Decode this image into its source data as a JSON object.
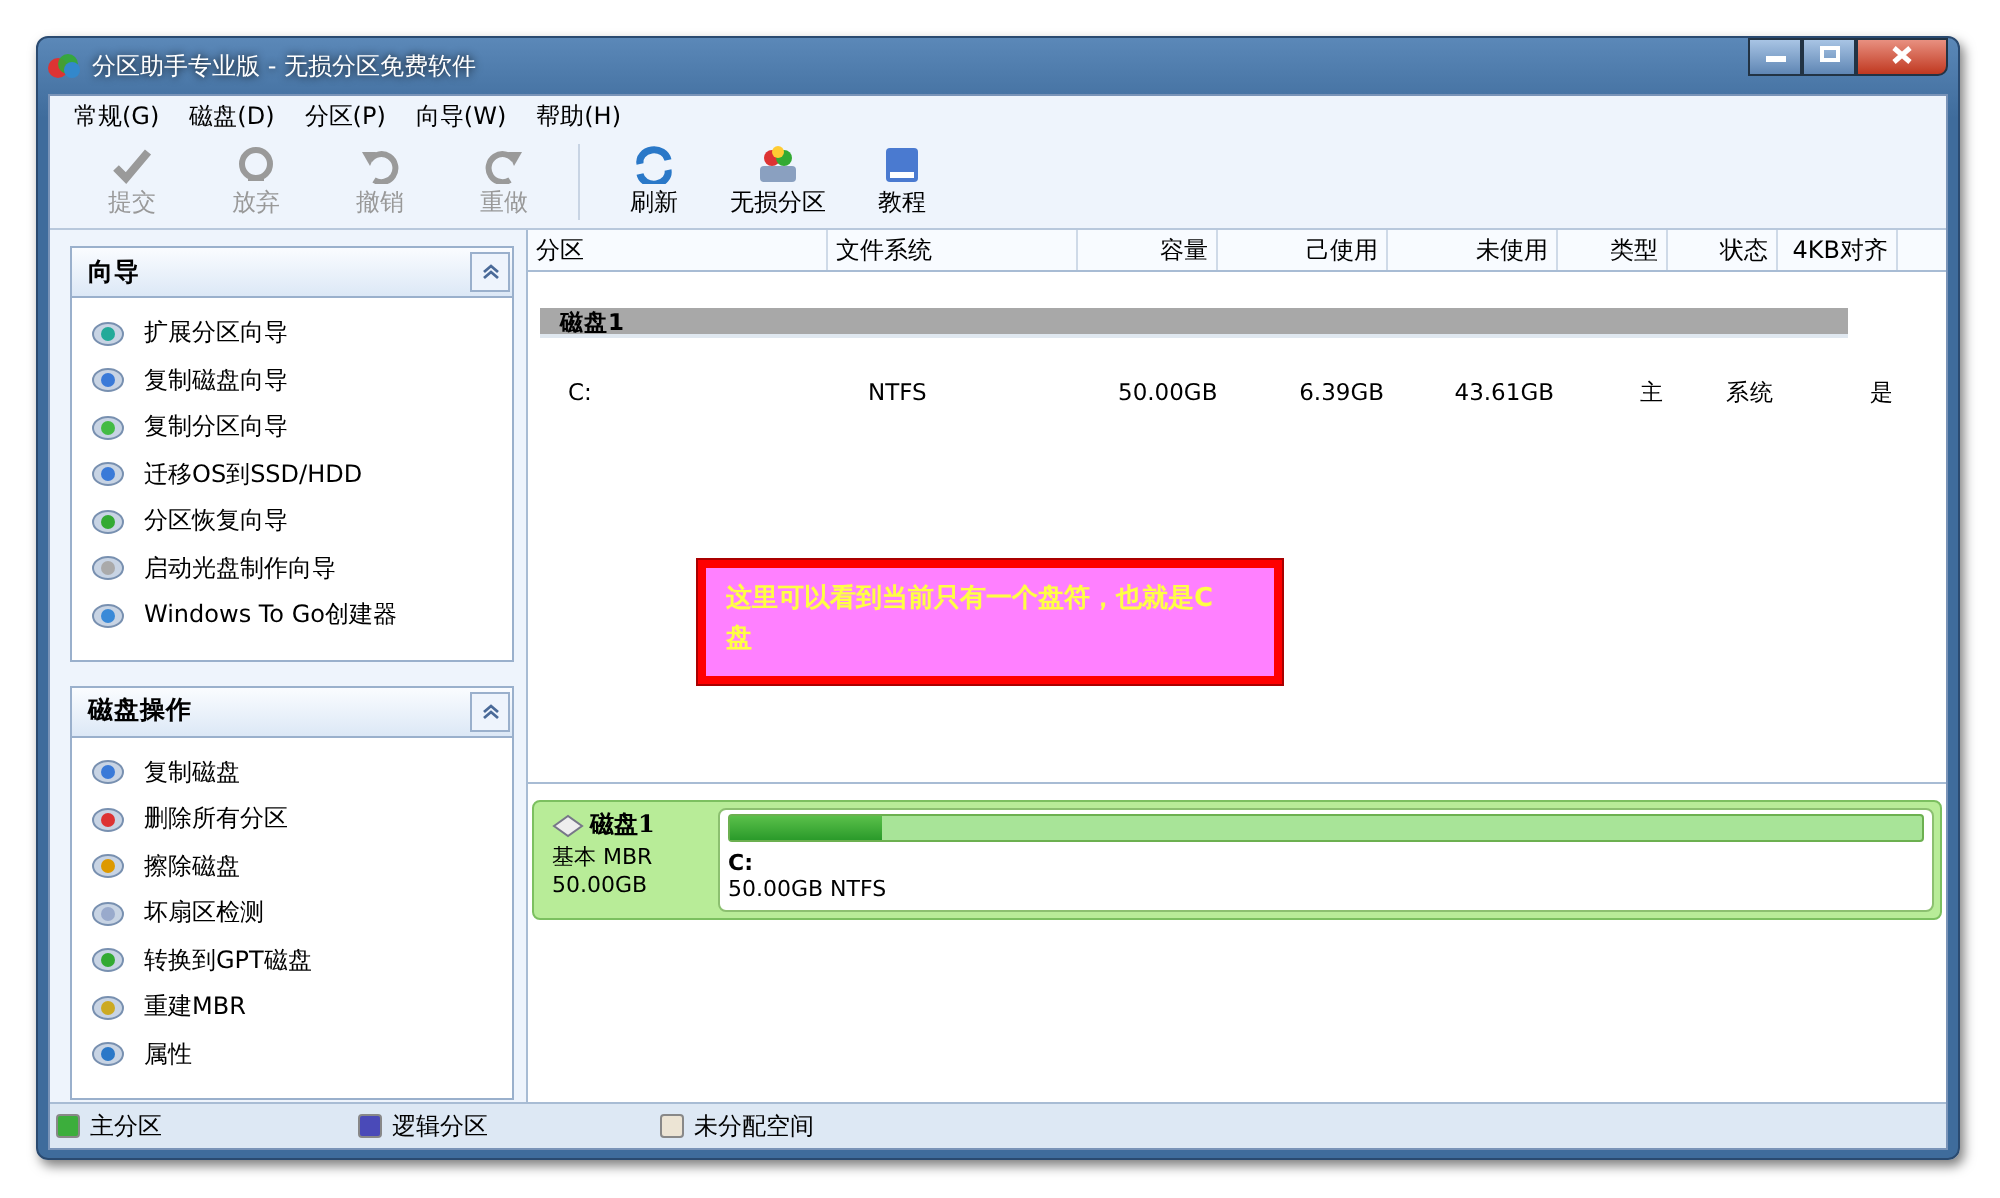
{
  "window": {
    "title": "分区助手专业版 - 无损分区免费软件"
  },
  "menu": [
    "常规(G)",
    "磁盘(D)",
    "分区(P)",
    "向导(W)",
    "帮助(H)"
  ],
  "toolbar": [
    {
      "label": "提交",
      "kind": "check",
      "disabled": true
    },
    {
      "label": "放弃",
      "kind": "discard",
      "disabled": true
    },
    {
      "label": "撤销",
      "kind": "undo",
      "disabled": true
    },
    {
      "label": "重做",
      "kind": "redo",
      "disabled": true
    },
    {
      "label": "刷新",
      "kind": "refresh",
      "disabled": false
    },
    {
      "label": "无损分区",
      "kind": "partition",
      "disabled": false
    },
    {
      "label": "教程",
      "kind": "book",
      "disabled": false
    }
  ],
  "sidebar": [
    {
      "title": "向导",
      "expanded": true,
      "items": [
        {
          "label": "扩展分区向导",
          "kind": "extend"
        },
        {
          "label": "复制磁盘向导",
          "kind": "copy"
        },
        {
          "label": "复制分区向导",
          "kind": "copypart"
        },
        {
          "label": "迁移OS到SSD/HDD",
          "kind": "copy"
        },
        {
          "label": "分区恢复向导",
          "kind": "recover"
        },
        {
          "label": "启动光盘制作向导",
          "kind": "cd"
        },
        {
          "label": "Windows To Go创建器",
          "kind": "windows"
        }
      ]
    },
    {
      "title": "磁盘操作",
      "expanded": true,
      "items": [
        {
          "label": "复制磁盘",
          "kind": "copy"
        },
        {
          "label": "删除所有分区",
          "kind": "delete"
        },
        {
          "label": "擦除磁盘",
          "kind": "wipe"
        },
        {
          "label": "坏扇区检测",
          "kind": "scan"
        },
        {
          "label": "转换到GPT磁盘",
          "kind": "recover"
        },
        {
          "label": "重建MBR",
          "kind": "mbr"
        },
        {
          "label": "属性",
          "kind": "info"
        }
      ]
    }
  ],
  "table": {
    "columns": [
      "分区",
      "文件系统",
      "容量",
      "己使用",
      "未使用",
      "类型",
      "状态",
      "4KB对齐"
    ],
    "groups": [
      {
        "title": "磁盘1",
        "rows": [
          [
            "C:",
            "NTFS",
            "50.00GB",
            "6.39GB",
            "43.61GB",
            "主",
            "系统",
            "是"
          ]
        ]
      }
    ]
  },
  "annotation": "这里可以看到当前只有一个盘符，也就是C盘",
  "disk_map": [
    {
      "name": "磁盘1",
      "type": "基本 MBR",
      "size": "50.00GB",
      "partitions": [
        {
          "label": "C:",
          "detail": "50.00GB NTFS",
          "level": 0.128
        }
      ]
    }
  ],
  "legend": [
    {
      "label": "主分区",
      "color": "#3cae3c"
    },
    {
      "label": "逻辑分区",
      "color": "#4a4ab8"
    },
    {
      "label": "未分配空间",
      "color": "#ece4d4"
    }
  ]
}
